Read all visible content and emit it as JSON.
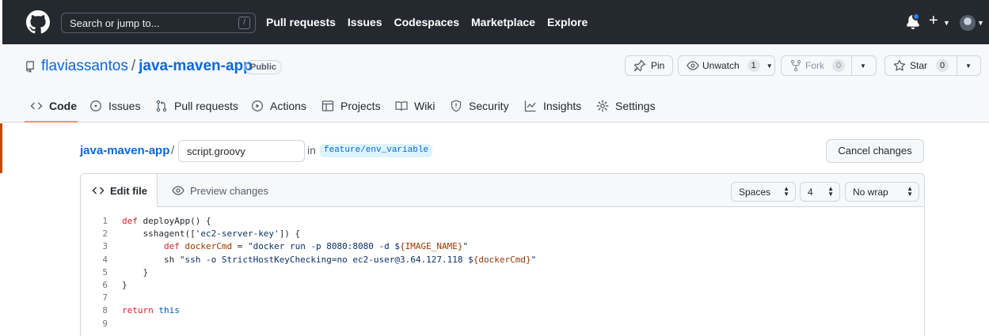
{
  "header": {
    "search_placeholder": "Search or jump to...",
    "search_shortcut": "/",
    "nav": [
      "Pull requests",
      "Issues",
      "Codespaces",
      "Marketplace",
      "Explore"
    ]
  },
  "repo": {
    "owner": "flaviassantos",
    "separator": "/",
    "name": "java-maven-app",
    "visibility": "Public",
    "actions": {
      "pin_label": "Pin",
      "unwatch_label": "Unwatch",
      "unwatch_count": "1",
      "fork_label": "Fork",
      "fork_count": "0",
      "star_label": "Star",
      "star_count": "0"
    },
    "tabs": [
      {
        "label": "Code",
        "icon": "code-icon",
        "selected": true
      },
      {
        "label": "Issues",
        "icon": "issue-opened-icon"
      },
      {
        "label": "Pull requests",
        "icon": "git-pull-request-icon"
      },
      {
        "label": "Actions",
        "icon": "play-icon"
      },
      {
        "label": "Projects",
        "icon": "table-icon"
      },
      {
        "label": "Wiki",
        "icon": "book-icon"
      },
      {
        "label": "Security",
        "icon": "shield-icon"
      },
      {
        "label": "Insights",
        "icon": "graph-icon"
      },
      {
        "label": "Settings",
        "icon": "gear-icon"
      }
    ]
  },
  "edit": {
    "breadcrumb_repo": "java-maven-app",
    "breadcrumb_sep": "/",
    "filename": "script.groovy",
    "in_label": "in",
    "branch": "feature/env_variable",
    "cancel_label": "Cancel changes"
  },
  "editor": {
    "tab_edit": "Edit file",
    "tab_preview": "Preview changes",
    "indent_mode": "Spaces",
    "indent_size": "4",
    "wrap_mode": "No wrap",
    "lines": [
      {
        "n": "1",
        "text": "def deployApp() {"
      },
      {
        "n": "2",
        "text": "    sshagent(['ec2-server-key']) {"
      },
      {
        "n": "3",
        "text": "        def dockerCmd = \"docker run -p 8080:8080 -d ${IMAGE_NAME}\""
      },
      {
        "n": "4",
        "text": "        sh \"ssh -o StrictHostKeyChecking=no ec2-user@3.64.127.118 ${dockerCmd}\""
      },
      {
        "n": "5",
        "text": "    }"
      },
      {
        "n": "6",
        "text": "}"
      },
      {
        "n": "7",
        "text": ""
      },
      {
        "n": "8",
        "text": "return this"
      },
      {
        "n": "9",
        "text": ""
      }
    ]
  },
  "colors": {
    "header_bg": "#24292f",
    "link": "#0969da",
    "tab_underline": "#fd8c73",
    "keyword": "#cf222e",
    "string": "#0a3069"
  }
}
